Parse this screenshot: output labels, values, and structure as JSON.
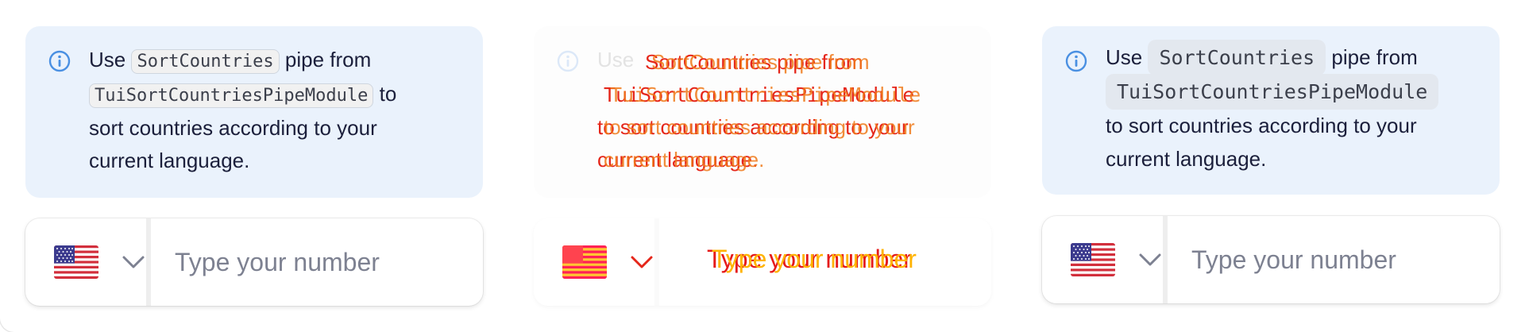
{
  "panels": {
    "left": {
      "notice": {
        "use": "Use",
        "pipe_name": "SortCountries",
        "pipe_from": "pipe from",
        "module_name": "TuiSortCountriesPipeModule",
        "to": "to",
        "rest": "sort countries according to your current language."
      },
      "phone": {
        "country": "United States",
        "placeholder": "Type your number"
      }
    },
    "center": {
      "notice": {
        "use": "Use",
        "line1": "SortCountries pipe from",
        "line2": "TuiSortCountriesPipeModule",
        "line3": "to sort countries according to your",
        "line4": "current language."
      },
      "phone": {
        "country": "United States",
        "placeholder": "Type your number"
      }
    },
    "right": {
      "notice": {
        "use": "Use",
        "pipe_name": "SortCountries",
        "pipe_from": "pipe from",
        "module_name": "TuiSortCountriesPipeModule",
        "rest": "to sort countries according to your current language."
      },
      "phone": {
        "country": "United States",
        "placeholder": "Type your number"
      }
    }
  },
  "colors": {
    "notice_bg": "#eaf2fc",
    "info_icon": "#4a90e2",
    "text": "#1b1f3b",
    "placeholder": "#7d8191",
    "glitch_red": "#e5261a"
  },
  "icons": {
    "info": "info-circle-icon",
    "chevron": "chevron-down-icon",
    "flag": "us-flag-icon"
  }
}
